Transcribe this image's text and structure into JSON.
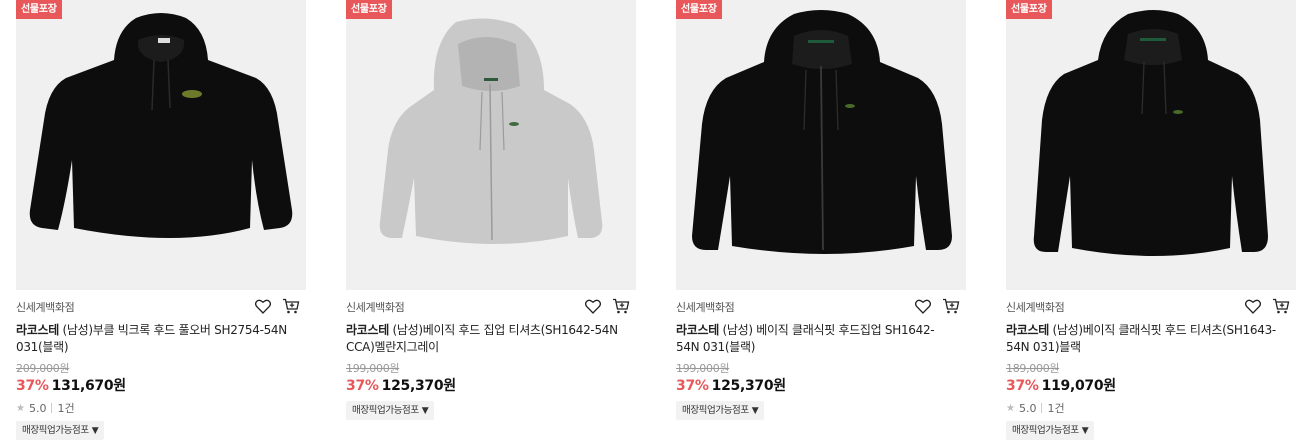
{
  "products": [
    {
      "badge": "선물포장",
      "store": "신세계백화점",
      "brand": "라코스테",
      "name": " (남성)부클 빅크록 후드 풀오버 SH2754-54N 031(블랙)",
      "original_price": "209,000원",
      "discount": "37%",
      "price": "131,670원",
      "rating": "5.0",
      "review_count": "1건",
      "pickup_label": "매장픽업가능점포",
      "pickup_arrow": "▼",
      "garment": "black-hoodie-pullover-icon"
    },
    {
      "badge": "선물포장",
      "store": "신세계백화점",
      "brand": "라코스테",
      "name": " (남성)베이직 후드 집업 티셔츠(SH1642-54N CCA)멜란지그레이",
      "original_price": "199,000원",
      "discount": "37%",
      "price": "125,370원",
      "pickup_label": "매장픽업가능점포",
      "pickup_arrow": "▼",
      "garment": "grey-zip-hoodie-icon"
    },
    {
      "badge": "선물포장",
      "store": "신세계백화점",
      "brand": "라코스테",
      "name": " (남성) 베이직 클래식핏 후드집업 SH1642-54N 031(블랙)",
      "original_price": "199,000원",
      "discount": "37%",
      "price": "125,370원",
      "pickup_label": "매장픽업가능점포",
      "pickup_arrow": "▼",
      "garment": "black-zip-hoodie-icon"
    },
    {
      "badge": "선물포장",
      "store": "신세계백화점",
      "brand": "라코스테",
      "name": " (남성)베이직 클래식핏 후드 티셔츠(SH1643-54N 031)블랙",
      "original_price": "189,000원",
      "discount": "37%",
      "price": "119,070원",
      "rating": "5.0",
      "review_count": "1건",
      "pickup_label": "매장픽업가능점포",
      "pickup_arrow": "▼",
      "garment": "black-hoodie-tee-icon"
    }
  ],
  "colors": {
    "badge_bg": "#e8585a",
    "discount": "#e8585a",
    "thumb_bg": "#f0f0f0",
    "black_garment": "#0d0d0d",
    "grey_garment": "#c9c9c9"
  }
}
